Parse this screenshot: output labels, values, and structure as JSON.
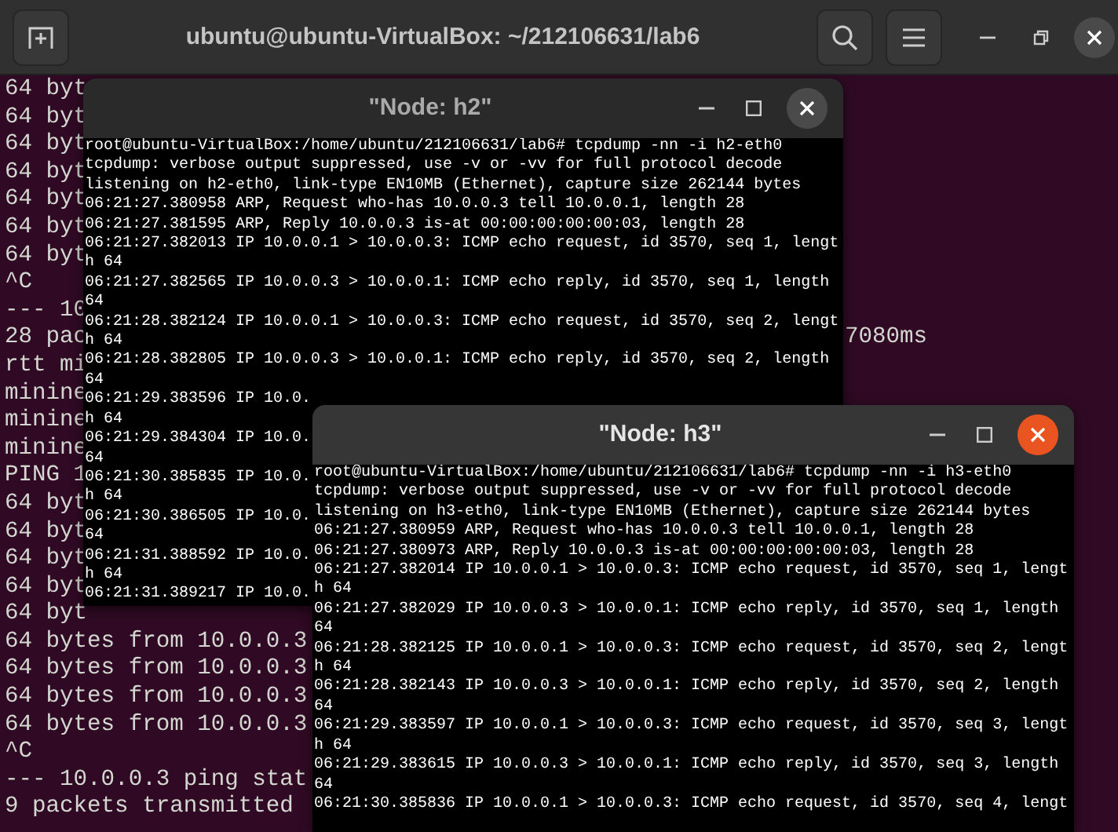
{
  "app_window": {
    "title": "ubuntu@ubuntu-VirtualBox: ~/212106631/lab6"
  },
  "background_terminal": {
    "lines": [
      {
        "text": "64 byt"
      },
      {
        "text": "64 byt"
      },
      {
        "text": "64 byt"
      },
      {
        "text": "64 byt"
      },
      {
        "text": "64 byt"
      },
      {
        "text": "64 byt"
      },
      {
        "text": "64 byt"
      },
      {
        "text": "^C"
      },
      {
        "text": "--- 10"
      },
      {
        "text": "28 pac",
        "tail": "7080ms"
      },
      {
        "text": "rtt mi"
      },
      {
        "text": "minine"
      },
      {
        "text": "minine"
      },
      {
        "text": "minine"
      },
      {
        "text": "PING 1"
      },
      {
        "text": "64 byt"
      },
      {
        "text": "64 byt"
      },
      {
        "text": "64 byt"
      },
      {
        "text": "64 byt"
      },
      {
        "text": "64 byt"
      },
      {
        "text": "64 bytes from 10.0.0.3"
      },
      {
        "text": "64 bytes from 10.0.0.3"
      },
      {
        "text": "64 bytes from 10.0.0.3"
      },
      {
        "text": "64 bytes from 10.0.0.3"
      },
      {
        "text": "^C"
      },
      {
        "text": "--- 10.0.0.3 ping stat"
      },
      {
        "text": "9 packets transmitted"
      }
    ]
  },
  "node_windows": [
    {
      "title": "\"Node: h2\"",
      "active": false,
      "lines": [
        "root@ubuntu-VirtualBox:/home/ubuntu/212106631/lab6# tcpdump -nn -i h2-eth0",
        "tcpdump: verbose output suppressed, use -v or -vv for full protocol decode",
        "listening on h2-eth0, link-type EN10MB (Ethernet), capture size 262144 bytes",
        "06:21:27.380958 ARP, Request who-has 10.0.0.3 tell 10.0.0.1, length 28",
        "06:21:27.381595 ARP, Reply 10.0.0.3 is-at 00:00:00:00:00:03, length 28",
        "06:21:27.382013 IP 10.0.0.1 > 10.0.0.3: ICMP echo request, id 3570, seq 1, lengt",
        "h 64",
        "06:21:27.382565 IP 10.0.0.3 > 10.0.0.1: ICMP echo reply, id 3570, seq 1, length",
        "64",
        "06:21:28.382124 IP 10.0.0.1 > 10.0.0.3: ICMP echo request, id 3570, seq 2, lengt",
        "h 64",
        "06:21:28.382805 IP 10.0.0.3 > 10.0.0.1: ICMP echo reply, id 3570, seq 2, length",
        "64",
        "06:21:29.383596 IP 10.0.",
        "h 64",
        "06:21:29.384304 IP 10.0.",
        "64",
        "06:21:30.385835 IP 10.0.",
        "h 64",
        "06:21:30.386505 IP 10.0.",
        "64",
        "06:21:31.388592 IP 10.0.",
        "h 64",
        "06:21:31.389217 IP 10.0."
      ]
    },
    {
      "title": "\"Node: h3\"",
      "active": true,
      "lines": [
        "root@ubuntu-VirtualBox:/home/ubuntu/212106631/lab6# tcpdump -nn -i h3-eth0",
        "tcpdump: verbose output suppressed, use -v or -vv for full protocol decode",
        "listening on h3-eth0, link-type EN10MB (Ethernet), capture size 262144 bytes",
        "06:21:27.380959 ARP, Request who-has 10.0.0.3 tell 10.0.0.1, length 28",
        "06:21:27.380973 ARP, Reply 10.0.0.3 is-at 00:00:00:00:00:03, length 28",
        "06:21:27.382014 IP 10.0.0.1 > 10.0.0.3: ICMP echo request, id 3570, seq 1, lengt",
        "h 64",
        "06:21:27.382029 IP 10.0.0.3 > 10.0.0.1: ICMP echo reply, id 3570, seq 1, length",
        "64",
        "06:21:28.382125 IP 10.0.0.1 > 10.0.0.3: ICMP echo request, id 3570, seq 2, lengt",
        "h 64",
        "06:21:28.382143 IP 10.0.0.3 > 10.0.0.1: ICMP echo reply, id 3570, seq 2, length",
        "64",
        "06:21:29.383597 IP 10.0.0.1 > 10.0.0.3: ICMP echo request, id 3570, seq 3, lengt",
        "h 64",
        "06:21:29.383615 IP 10.0.0.3 > 10.0.0.1: ICMP echo reply, id 3570, seq 3, length",
        "64",
        "06:21:30.385836 IP 10.0.0.1 > 10.0.0.3: ICMP echo request, id 3570, seq 4, lengt"
      ]
    }
  ]
}
